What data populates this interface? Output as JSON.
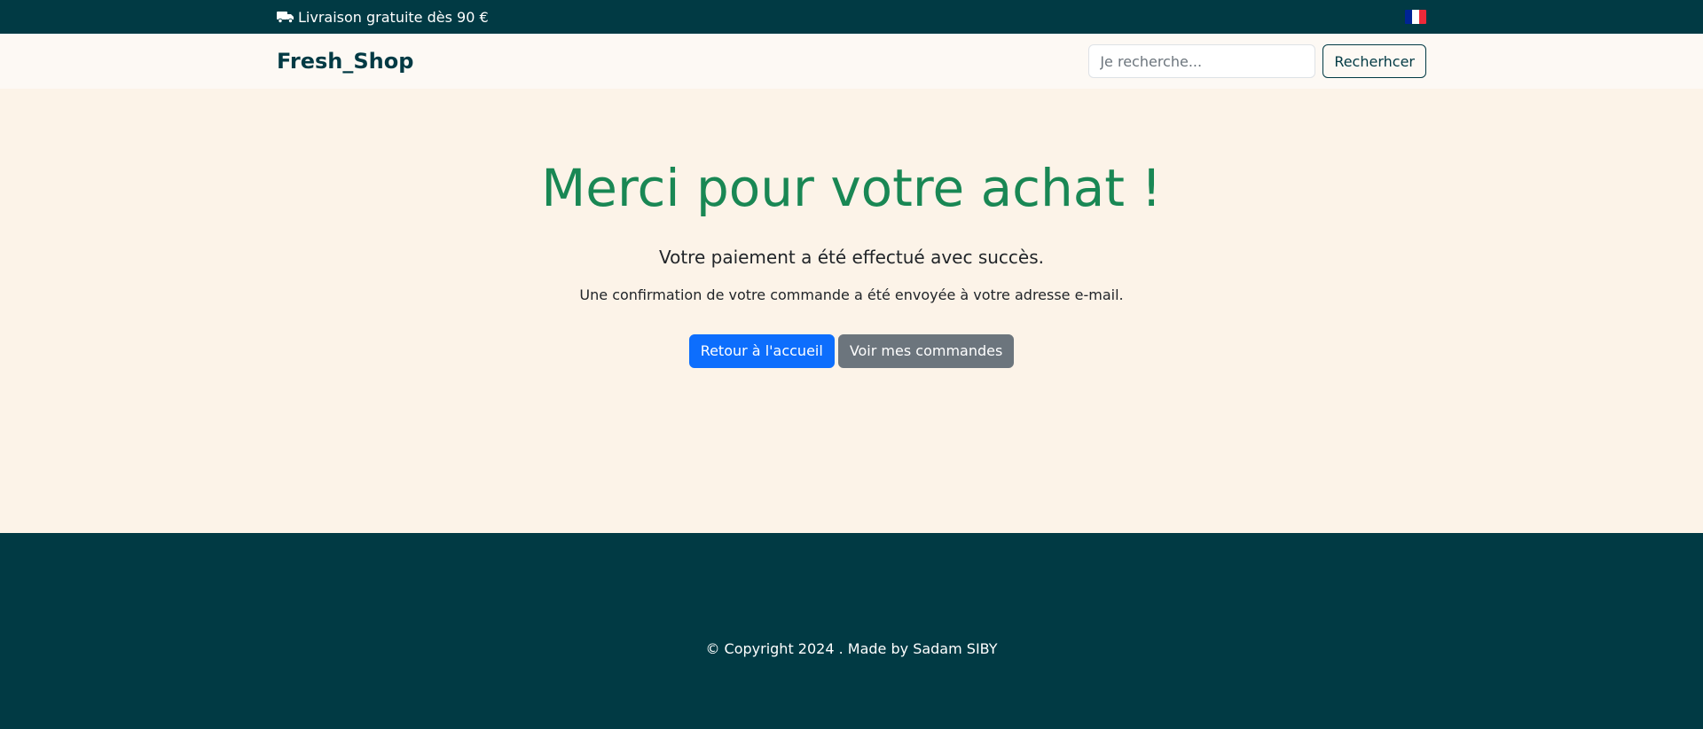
{
  "topbar": {
    "promo_text": "Livraison gratuite dès 90 €",
    "promo_icon": "truck-icon",
    "language_flag": "flag-fr-icon",
    "flag_colors": [
      "#002395",
      "#ffffff",
      "#ed2939"
    ]
  },
  "navbar": {
    "brand": "Fresh_Shop",
    "search_placeholder": "Je recherche...",
    "search_button": "Recherhcer"
  },
  "main": {
    "title": "Merci pour votre achat !",
    "lead": "Votre paiement a été effectué avec succès.",
    "confirmation": "Une confirmation de votre commande a été envoyée à votre adresse e-mail.",
    "home_button": "Retour à l'accueil",
    "orders_button": "Voir mes commandes"
  },
  "footer": {
    "copyright": "© Copyright 2024 . Made by Sadam SIBY"
  },
  "colors": {
    "dark_teal": "#013a44",
    "page_background": "#fcf3e8",
    "navbar_background": "#fdf9f4",
    "success_green": "#198754",
    "primary_blue": "#0d6efd",
    "secondary_gray": "#6c757d"
  }
}
